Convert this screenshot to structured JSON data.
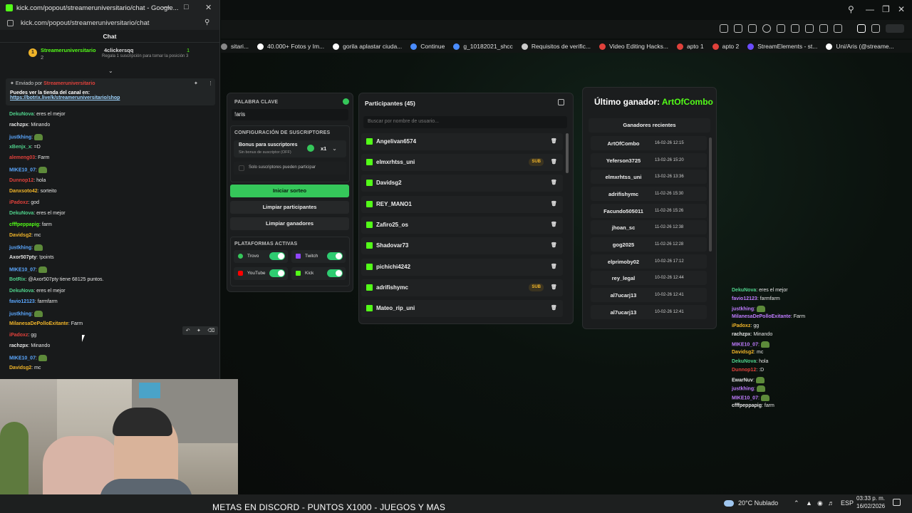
{
  "chat_window": {
    "title": "kick.com/popout/streameruniversitario/chat - Google...",
    "url": "kick.com/popout/streameruniversitario/chat",
    "header": "Chat",
    "leaderboard": {
      "rank": "1",
      "name1": "Streameruniversitario",
      "sub1": "2",
      "name2": "4clickersqq",
      "count": "1",
      "note": "Regala 1 suscripción para tomar la posición 3"
    },
    "pinned": {
      "sent_by": "Enviado por",
      "author": "Streameruniversitario",
      "message": "Puedes ver la tienda del canal en:",
      "link": "https://botrix.live/k/streameruniversitario/shop"
    },
    "messages": [
      {
        "user": "DekuNova",
        "color": "#4fd18b",
        "text": ": eres el mejor"
      },
      {
        "user": "rachzpx",
        "color": "#e6e6e6",
        "text": ": Minando"
      },
      {
        "user": "justkhing",
        "color": "#5ba8ff",
        "text": ": "
      },
      {
        "user": "xBenjx_x",
        "color": "#4fd18b",
        "text": ": =D"
      },
      {
        "user": "alemeng03",
        "color": "#e0413b",
        "text": ": Farm"
      },
      {
        "user": "MIKE10_07",
        "color": "#5ba8ff",
        "text": ": "
      },
      {
        "user": "Dunnop12",
        "color": "#e0413b",
        "text": ": hola"
      },
      {
        "user": "Danxsoto42",
        "color": "#f0b429",
        "text": ": sorteito"
      },
      {
        "user": "iPadoxz",
        "color": "#e0413b",
        "text": ": god"
      },
      {
        "user": "DekuNova",
        "color": "#4fd18b",
        "text": ": eres el mejor"
      },
      {
        "user": "cfffpeppapig",
        "color": "#53fc18",
        "text": ": farm"
      },
      {
        "user": "Davidsg2",
        "color": "#f0b429",
        "text": ": mc"
      },
      {
        "user": "justkhing",
        "color": "#5ba8ff",
        "text": ": "
      },
      {
        "user": "Axor507pty",
        "color": "#e6e6e6",
        "text": ": !points"
      },
      {
        "user": "MIKE10_07",
        "color": "#5ba8ff",
        "text": ": "
      },
      {
        "user": "BotRix",
        "color": "#4fd18b",
        "text": ": @Axor507pty tiene 68125 puntos."
      },
      {
        "user": "DekuNova",
        "color": "#4fd18b",
        "text": ": eres el mejor"
      },
      {
        "user": "favio12123",
        "color": "#5ba8ff",
        "text": ": farmfarm"
      },
      {
        "user": "justkhing",
        "color": "#5ba8ff",
        "text": ": "
      },
      {
        "user": "MilanesaDePolloExitante",
        "color": "#f0b429",
        "text": ": Farm"
      },
      {
        "user": "iPadoxz",
        "color": "#e0413b",
        "text": ": gg"
      },
      {
        "user": "rachzpx",
        "color": "#e6e6e6",
        "text": ": Minando"
      },
      {
        "user": "MIKE10_07",
        "color": "#5ba8ff",
        "text": ": "
      },
      {
        "user": "Davidsg2",
        "color": "#f0b429",
        "text": ": mc"
      }
    ]
  },
  "bookmarks": [
    {
      "label": "sitari...",
      "color": "#888888"
    },
    {
      "label": "40.000+ Fotos y Im...",
      "color": "#ffffff"
    },
    {
      "label": "gorila aplastar ciuda...",
      "color": "#ffffff"
    },
    {
      "label": "Continue",
      "color": "#4a8cff"
    },
    {
      "label": "g_10182021_shcc",
      "color": "#4a8cff"
    },
    {
      "label": "Requisitos de verific...",
      "color": "#cccccc"
    },
    {
      "label": "Video Editing Hacks...",
      "color": "#e0413b"
    },
    {
      "label": "apto 1",
      "color": "#e0413b"
    },
    {
      "label": "apto 2",
      "color": "#e0413b"
    },
    {
      "label": "StreamElements - st...",
      "color": "#6b4cff"
    },
    {
      "label": "Uni/Aris (@streame...",
      "color": "#ffffff"
    }
  ],
  "settings": {
    "keyword_label": "PALABRA CLAVE",
    "keyword_value": "!aris",
    "subs_config_label": "CONFIGURACIÓN DE SUSCRIPTORES",
    "bonus_label": "Bonus para suscriptores",
    "bonus_sub": "Sin bonus de suscriptor (OFF)",
    "multiplier": "x1",
    "subs_only_label": "Solo suscriptores pueden participar",
    "start_button": "Iniciar sorteo",
    "clear_participants": "Limpiar participantes",
    "clear_winners": "Limpiar ganadores",
    "platforms_label": "PLATAFORMAS ACTIVAS",
    "platforms": [
      "Trovo",
      "Twitch",
      "YouTube",
      "Kick"
    ]
  },
  "participants": {
    "title": "Participantes (45)",
    "search_placeholder": "Buscar por nombre de usuario...",
    "sub_badge": "SUB",
    "list": [
      {
        "name": "Angelivan6574",
        "sub": false
      },
      {
        "name": "elmxrhtss_uni",
        "sub": true
      },
      {
        "name": "Davidsg2",
        "sub": false
      },
      {
        "name": "REY_MANO1",
        "sub": false
      },
      {
        "name": "Zafiro25_os",
        "sub": false
      },
      {
        "name": "Shadovar73",
        "sub": false
      },
      {
        "name": "pichichi4242",
        "sub": false
      },
      {
        "name": "adrifishymc",
        "sub": true
      },
      {
        "name": "Mateo_rip_uni",
        "sub": false
      }
    ]
  },
  "winners": {
    "last_winner_label": "Último ganador:",
    "last_winner": "ArtOfCombo",
    "recent_title": "Ganadores recientes",
    "list": [
      {
        "name": "ArtOfCombo",
        "date": "16-02-26 12:15"
      },
      {
        "name": "Yeferson3725",
        "date": "13-02-26 15:20"
      },
      {
        "name": "elmxrhtss_uni",
        "date": "13-02-26 13:36"
      },
      {
        "name": "adrifishymc",
        "date": "11-02-26 15:30"
      },
      {
        "name": "Facundo505011",
        "date": "11-02-26 15:26"
      },
      {
        "name": "jhoan_sc",
        "date": "11-02-26 12:38"
      },
      {
        "name": "gog2025",
        "date": "11-02-26 12:28"
      },
      {
        "name": "elprimoby02",
        "date": "10-02-26 17:12"
      },
      {
        "name": "rey_legal",
        "date": "10-02-26 12:44"
      },
      {
        "name": "al7ucarj13",
        "date": "10-02-26 12:41"
      },
      {
        "name": "al7ucarj13",
        "date": "10-02-26 12:41"
      }
    ]
  },
  "overlay_chat": [
    {
      "user": "DekuNova",
      "color": "#4fd18b",
      "text": ": eres el mejor"
    },
    {
      "user": "favio12123",
      "color": "#c07cff",
      "text": ": farmfarm"
    },
    {
      "user": "justkhing",
      "color": "#c07cff",
      "text": ": "
    },
    {
      "user": "MilanesaDePolloExitante",
      "color": "#c07cff",
      "text": ": Farm"
    },
    {
      "user": "iPadoxz",
      "color": "#f0b429",
      "text": ": gg"
    },
    {
      "user": "rachzpx",
      "color": "#e6e6e6",
      "text": ": Minando"
    },
    {
      "user": "MIKE10_07",
      "color": "#c07cff",
      "text": ": "
    },
    {
      "user": "Davidsg2",
      "color": "#f0b429",
      "text": ": mc"
    },
    {
      "user": "DekuNova",
      "color": "#4fd18b",
      "text": ": hola"
    },
    {
      "user": "Dunnop12",
      "color": "#e0413b",
      "text": ": :D"
    },
    {
      "user": "EwarNuv",
      "color": "#e6e6e6",
      "text": ": "
    },
    {
      "user": "justkhing",
      "color": "#c07cff",
      "text": ": "
    },
    {
      "user": "MIKE10_07",
      "color": "#c07cff",
      "text": ": "
    },
    {
      "user": "cfffpeppapig",
      "color": "#e6e6e6",
      "text": ": farm"
    }
  ],
  "ticker": "METAS EN DISCORD - PUNTOS X1000 - JUEGOS Y MAS",
  "tray": {
    "weather": "20°C Nublado",
    "lang": "ESP",
    "time": "03:33 p. m.",
    "date": "16/02/2026"
  },
  "colors": {
    "kick_green": "#53fc18",
    "accent_green": "#35c75a"
  }
}
